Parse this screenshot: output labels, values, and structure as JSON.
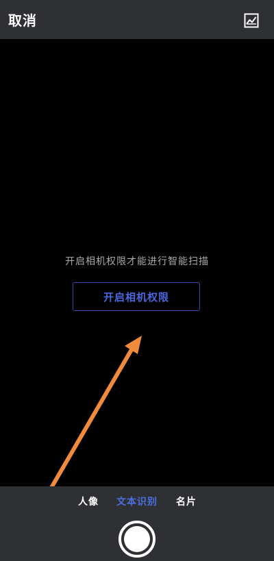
{
  "header": {
    "cancel_label": "取消",
    "gallery_icon": "image-chart-icon"
  },
  "main": {
    "permission_prompt": "开启相机权限才能进行智能扫描",
    "permission_button_label": "开启相机权限"
  },
  "annotation": {
    "arrow_color": "#f28a3c"
  },
  "bottom": {
    "modes": [
      {
        "label": "人像",
        "active": false
      },
      {
        "label": "文本识别",
        "active": true
      },
      {
        "label": "名片",
        "active": false
      }
    ],
    "active_color": "#4a6fe0",
    "shutter_icon": "shutter-button-icon"
  }
}
